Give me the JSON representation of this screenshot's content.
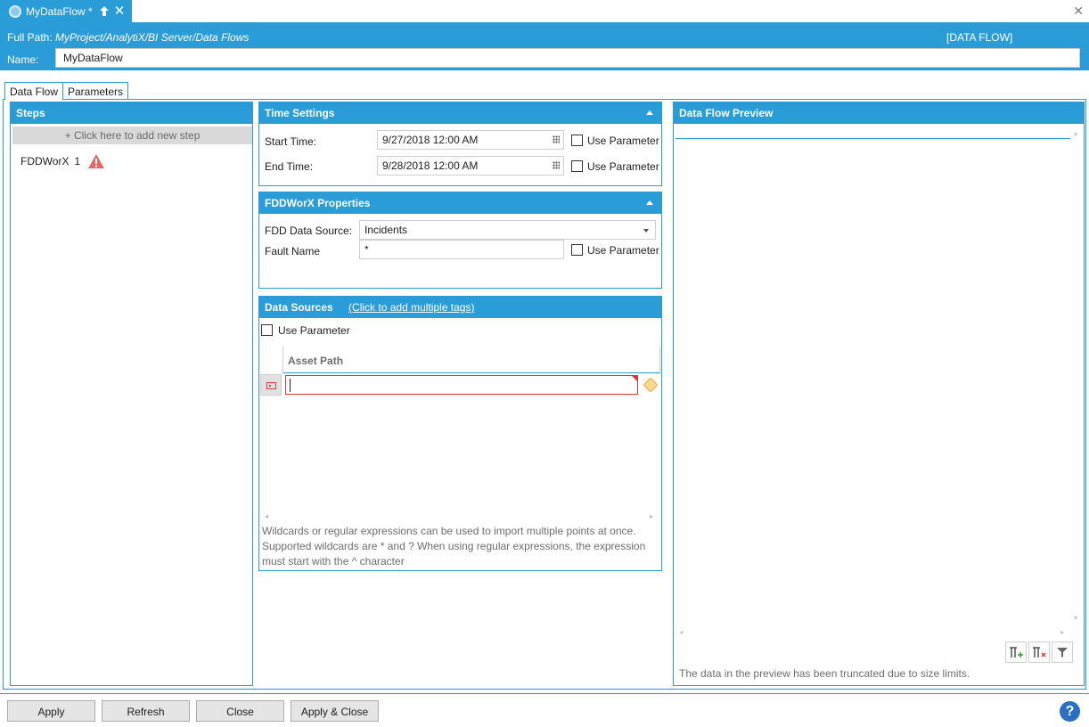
{
  "doc_tab": {
    "title": "MyDataFlow *",
    "close": "✕"
  },
  "window_close": "✕",
  "header": {
    "full_path_label": "Full Path:",
    "full_path_value": "MyProject/AnalytiX/BI Server/Data Flows",
    "type_label": "[DATA FLOW]",
    "name_label": "Name:",
    "name_value": "MyDataFlow"
  },
  "tabs": [
    {
      "label": "Data Flow",
      "active": true
    },
    {
      "label": "Parameters",
      "active": false
    }
  ],
  "steps": {
    "title": "Steps",
    "add_step": "+ Click here to add new step",
    "items": [
      {
        "name": "FDDWorX",
        "number": "1",
        "status_icon": "warning-icon"
      }
    ]
  },
  "time_settings": {
    "title": "Time Settings",
    "start_label": "Start Time:",
    "start_value": "9/27/2018 12:00 AM",
    "end_label": "End Time:",
    "end_value": "9/28/2018 12:00 AM",
    "use_parameter": "Use Parameter"
  },
  "fdd_properties": {
    "title": "FDDWorX Properties",
    "source_label": "FDD Data Source:",
    "source_value": "Incidents",
    "fault_label": "Fault Name",
    "fault_value": "*",
    "use_parameter": "Use Parameter"
  },
  "data_sources": {
    "title": "Data Sources",
    "link": "(Click to add multiple tags)",
    "use_parameter": "Use Parameter",
    "column_header": "Asset Path",
    "asset_value": "",
    "hint": "Wildcards or regular expressions can be used to import multiple points at once. Supported wildcards are * and ? When using regular expressions, the expression must start with the ^ character"
  },
  "preview": {
    "title": "Data Flow Preview",
    "truncated": "The data in the preview has been truncated due to size limits."
  },
  "buttons": {
    "apply": "Apply",
    "refresh": "Refresh",
    "close": "Close",
    "apply_close": "Apply & Close",
    "help": "?"
  },
  "colors": {
    "accent": "#2a9dd8",
    "error": "#d53b3b",
    "button": "#e5e5e5"
  }
}
